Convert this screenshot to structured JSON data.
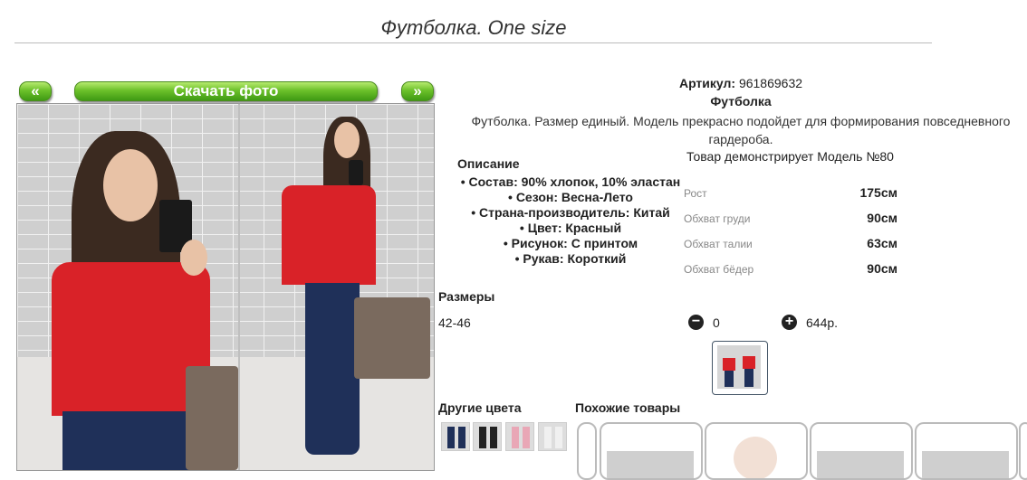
{
  "page": {
    "title": "Футболка. One size"
  },
  "gallery": {
    "prev_label": "«",
    "download_label": "Скачать фото",
    "next_label": "»"
  },
  "product": {
    "article_label": "Артикул:",
    "article_value": "961869632",
    "name": "Футболка",
    "description": "Футболка. Размер единый. Модель прекрасно подойдет для формирования повседневного гардероба.",
    "model_note": "Товар демонстрирует Модель №80"
  },
  "details": {
    "heading": "Описание",
    "items": [
      "• Состав: 90% хлопок, 10% эластан",
      "• Сезон: Весна-Лето",
      "• Страна-производитель: Китай",
      "• Цвет: Красный",
      "• Рисунок: С принтом",
      "• Рукав: Короткий"
    ]
  },
  "measurements": [
    {
      "label": "Рост",
      "value": "175см"
    },
    {
      "label": "Обхват груди",
      "value": "90см"
    },
    {
      "label": "Обхват талии",
      "value": "63см"
    },
    {
      "label": "Обхват бёдер",
      "value": "90см"
    }
  ],
  "sizes": {
    "heading": "Размеры",
    "size": "42-46",
    "minus": "−",
    "quantity": "0",
    "plus": "+",
    "price": "644р."
  },
  "other_colors": {
    "heading": "Другие цвета"
  },
  "similar": {
    "heading": "Похожие товары"
  },
  "colors": {
    "accent_green": "#6cc12a",
    "shirt_red": "#d92228"
  }
}
